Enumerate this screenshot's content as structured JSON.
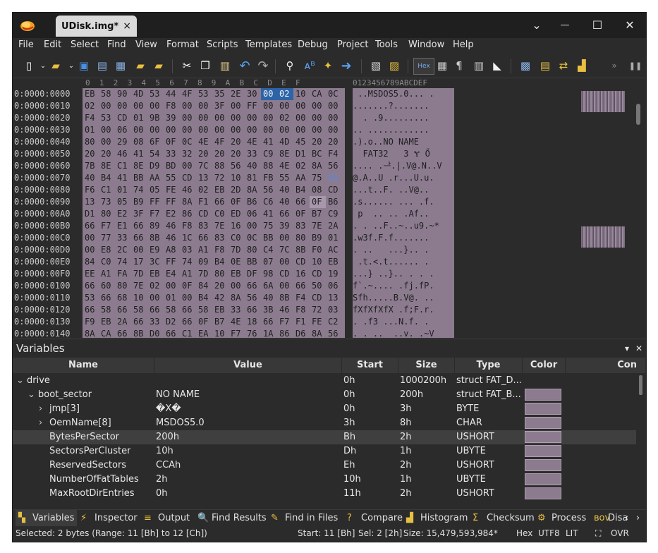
{
  "window": {
    "tab_title": "UDisk.img*",
    "tab_close": "×",
    "dropdown": "⌄",
    "minimize": "—",
    "maximize": "☐",
    "close": "✕"
  },
  "menu": [
    "File",
    "Edit",
    "Select",
    "Find",
    "View",
    "Format",
    "Scripts",
    "Templates",
    "Debug",
    "Project",
    "Tools",
    "Window",
    "Help"
  ],
  "toolbar": {
    "hex_label": "Hex",
    "more": "»"
  },
  "hex": {
    "column_header": "0  1  2  3  4  5  6  7  8  9  A  B  C  D  E  F",
    "text_header": "0123456789ABCDEF",
    "addresses": [
      "0:0000:0000",
      "0:0000:0010",
      "0:0000:0020",
      "0:0000:0030",
      "0:0000:0040",
      "0:0000:0050",
      "0:0000:0060",
      "0:0000:0070",
      "0:0000:0080",
      "0:0000:0090",
      "0:0000:00A0",
      "0:0000:00B0",
      "0:0000:00C0",
      "0:0000:00D0",
      "0:0000:00E0",
      "0:0000:00F0",
      "0:0000:0100",
      "0:0000:0110",
      "0:0000:0120",
      "0:0000:0130",
      "0:0000:0140"
    ],
    "rows": [
      "EB 58 90 4D 53 44 4F 53 35 2E 30 00 02 10 CA 0C",
      "02 00 00 00 00 F8 00 00 3F 00 FF 00 00 00 00 00",
      "F4 53 CD 01 9B 39 00 00 00 00 00 00 02 00 00 00",
      "01 00 06 00 00 00 00 00 00 00 00 00 00 00 00 00",
      "80 00 29 08 6F 0F 0C 4E 4F 20 4E 41 4D 45 20 20",
      "20 20 46 41 54 33 32 20 20 20 33 C9 8E D1 BC F4",
      "7B 8E C1 8E D9 BD 00 7C 88 56 40 88 4E 02 8A 56",
      "40 B4 41 BB AA 55 CD 13 72 10 81 FB 55 AA 75 0A",
      "F6 C1 01 74 05 FE 46 02 EB 2D 8A 56 40 B4 08 CD",
      "13 73 05 B9 FF FF 8A F1 66 0F B6 C6 40 66 0F B6",
      "D1 80 E2 3F F7 E2 86 CD C0 ED 06 41 66 0F B7 C9",
      "66 F7 E1 66 89 46 F8 83 7E 16 00 75 39 83 7E 2A",
      "00 77 33 66 8B 46 1C 66 83 C0 0C BB 00 80 B9 01",
      "00 E8 2C 00 E9 A8 03 A1 F8 7D 80 C4 7C 8B F0 AC",
      "84 C0 74 17 3C FF 74 09 B4 0E BB 07 00 CD 10 EB",
      "EE A1 FA 7D EB E4 A1 7D 80 EB DF 98 CD 16 CD 19",
      "66 60 80 7E 02 00 0F 84 20 00 66 6A 00 66 50 06",
      "53 66 68 10 00 01 00 B4 42 8A 56 40 8B F4 CD 13",
      "66 58 66 58 66 58 66 58 EB 33 66 3B 46 F8 72 03",
      "F9 EB 2A 66 33 D2 66 0F B7 4E 18 66 F7 F1 FE C2",
      "8A CA 66 8B D0 66 C1 EA 10 F7 76 1A 86 D6 8A 56"
    ],
    "text_rows": [
      " ..MSDOS5.0... .",
      ".......?.......",
      "  . .9.........",
      ".. ............",
      ".).o..NO NAME  ",
      "  FAT32   3 Ɏ Ő",
      ".... .ᆣ.|.V@.N..V",
      "@.A..U .r...U.u.",
      "...t..F. ..V@..",
      ".s...... ... .f.",
      " p  .. .. .Af..",
      ". . ..F..~..u9.~*",
      ".w3f.F.f.......",
      ". ..   ...}.. .",
      " .t.<.t...... .",
      "...} ..}.. . . .",
      "f`.~.... .fj.fP.",
      "Sfh.....B.V@. ..",
      "fXfXfXfX .f;F.r.",
      ". .f3 ...N.f. .",
      ". . ..  ..v. .~V"
    ]
  },
  "variables": {
    "panel_title": "Variables",
    "pin": "▾",
    "close": "✕",
    "columns": [
      "Name",
      "Value",
      "Start",
      "Size",
      "Type",
      "Color",
      "Con"
    ],
    "rows": [
      {
        "indent": 0,
        "arrow": "⌄",
        "name": "drive",
        "value": "",
        "start": "0h",
        "size": "1000200h",
        "type": "struct FAT_D...",
        "swatch": false
      },
      {
        "indent": 1,
        "arrow": "⌄",
        "name": "boot_sector",
        "value": "NO NAME",
        "start": "0h",
        "size": "200h",
        "type": "struct FAT_B...",
        "swatch": true
      },
      {
        "indent": 2,
        "arrow": "›",
        "name": "jmp[3]",
        "value": "�X�",
        "start": "0h",
        "size": "3h",
        "type": "BYTE",
        "swatch": true
      },
      {
        "indent": 2,
        "arrow": "›",
        "name": "OemName[8]",
        "value": "MSDOS5.0",
        "start": "3h",
        "size": "8h",
        "type": "CHAR",
        "swatch": true
      },
      {
        "indent": 2,
        "arrow": "",
        "name": "BytesPerSector",
        "value": "200h",
        "start": "Bh",
        "size": "2h",
        "type": "USHORT",
        "swatch": true,
        "selected": true
      },
      {
        "indent": 2,
        "arrow": "",
        "name": "SectorsPerCluster",
        "value": "10h",
        "start": "Dh",
        "size": "1h",
        "type": "UBYTE",
        "swatch": true
      },
      {
        "indent": 2,
        "arrow": "",
        "name": "ReservedSectors",
        "value": "CCAh",
        "start": "Eh",
        "size": "2h",
        "type": "USHORT",
        "swatch": true
      },
      {
        "indent": 2,
        "arrow": "",
        "name": "NumberOfFatTables",
        "value": "2h",
        "start": "10h",
        "size": "1h",
        "type": "UBYTE",
        "swatch": true
      },
      {
        "indent": 2,
        "arrow": "",
        "name": "MaxRootDirEntries",
        "value": "0h",
        "start": "11h",
        "size": "2h",
        "type": "USHORT",
        "swatch": true
      }
    ]
  },
  "bottom_tabs": [
    {
      "icon": "▚",
      "label": "Variables",
      "active": true
    },
    {
      "icon": "⚡",
      "label": "Inspector"
    },
    {
      "icon": "≡",
      "label": "Output"
    },
    {
      "icon": "🔍",
      "label": "Find Results"
    },
    {
      "icon": "✎",
      "label": "Find in Files"
    },
    {
      "icon": "?",
      "label": "Compare"
    },
    {
      "icon": "▟",
      "label": "Histogram"
    },
    {
      "icon": "Σ",
      "label": "Checksum"
    },
    {
      "icon": "⚙",
      "label": "Process"
    },
    {
      "icon": "ʙᴏᴠ",
      "label": "Disa"
    }
  ],
  "tab_nav": {
    "left": "‹",
    "right": "›"
  },
  "status": {
    "selection": "Selected: 2 bytes (Range: 11 [Bh] to 12 [Ch])",
    "start": "Start: 11 [Bh]",
    "sel": "Sel: 2 [2h]",
    "size": "Size: 15,479,593,984*",
    "hex": "Hex",
    "encoding": "UTF8",
    "endian": "LIT",
    "ovr": "OVR"
  }
}
